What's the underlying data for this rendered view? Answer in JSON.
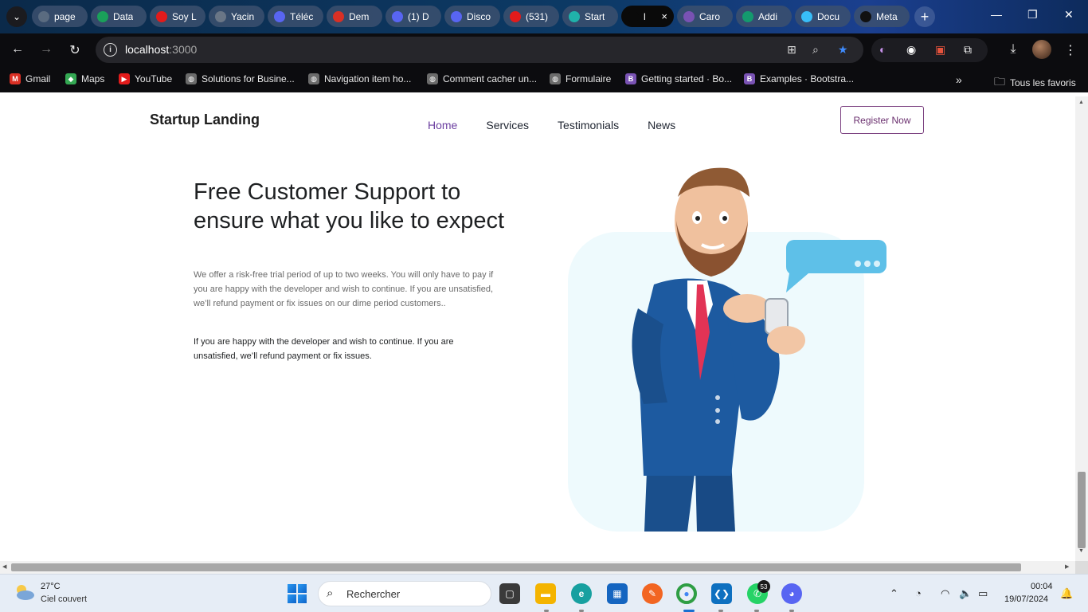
{
  "browser": {
    "tabs": [
      {
        "label": "page",
        "color": "#5a6b80"
      },
      {
        "label": "Data",
        "color": "#1aa05a"
      },
      {
        "label": "Soy L",
        "color": "#e21b1b"
      },
      {
        "label": "Yacin",
        "color": "#6a7686"
      },
      {
        "label": "Téléc",
        "color": "#5865f2"
      },
      {
        "label": "Dem",
        "color": "#d93025"
      },
      {
        "label": "(1) D",
        "color": "#5865f2"
      },
      {
        "label": "Disco",
        "color": "#5865f2"
      },
      {
        "label": "(531)",
        "color": "#e21b1b"
      },
      {
        "label": "Start",
        "color": "#20b2aa"
      },
      {
        "label": "l",
        "color": "#0a0a0a"
      },
      {
        "label": "Caro",
        "color": "#7952b3"
      },
      {
        "label": "Addi",
        "color": "#149a6e"
      },
      {
        "label": "Docu",
        "color": "#38bdf8"
      },
      {
        "label": "Meta",
        "color": "#111111"
      }
    ],
    "active_tab_close": "×",
    "new_tab": "+",
    "url_host": "localhost",
    "url_port": ":3000",
    "bookmarks": [
      {
        "label": "Gmail",
        "color": "#d93025",
        "glyph": "M"
      },
      {
        "label": "Maps",
        "color": "#34a853",
        "glyph": "◆"
      },
      {
        "label": "YouTube",
        "color": "#e21b1b",
        "glyph": "▶"
      },
      {
        "label": "Solutions for Busine...",
        "color": "#6b6b6b",
        "glyph": "◍"
      },
      {
        "label": "Navigation item ho...",
        "color": "#6b6b6b",
        "glyph": "◍"
      },
      {
        "label": "Comment cacher un...",
        "color": "#6b6b6b",
        "glyph": "◍"
      },
      {
        "label": "Formulaire",
        "color": "#6b6b6b",
        "glyph": "◍"
      },
      {
        "label": "Getting started · Bo...",
        "color": "#7952b3",
        "glyph": "B"
      },
      {
        "label": "Examples · Bootstra...",
        "color": "#7952b3",
        "glyph": "B"
      }
    ],
    "bookmarks_overflow": "»",
    "all_bookmarks": "Tous les favoris"
  },
  "site": {
    "brand": "Startup Landing",
    "nav": [
      "Home",
      "Services",
      "Testimonials",
      "News"
    ],
    "register_label": "Register Now",
    "hero_title": "Free Customer Support to ensure what you like to expect",
    "hero_p1": "We offer a risk-free trial period of up to two weeks. You will only have to pay if you are happy with the developer and wish to continue. If you are unsatisfied, we’ll refund payment or fix issues on our dime period customers..",
    "hero_p2": "If you are happy with the developer and wish to continue. If you are unsatisfied, we’ll refund payment or fix issues."
  },
  "taskbar": {
    "weather_temp": "27°C",
    "weather_desc": "Ciel couvert",
    "search_placeholder": "Rechercher",
    "whatsapp_badge": "53",
    "clock_time": "00:04",
    "clock_date": "19/07/2024"
  },
  "colors": {
    "accent": "#6b3fa0",
    "register_border": "#7a3f7f",
    "illustration_bg": "#eefafd"
  }
}
